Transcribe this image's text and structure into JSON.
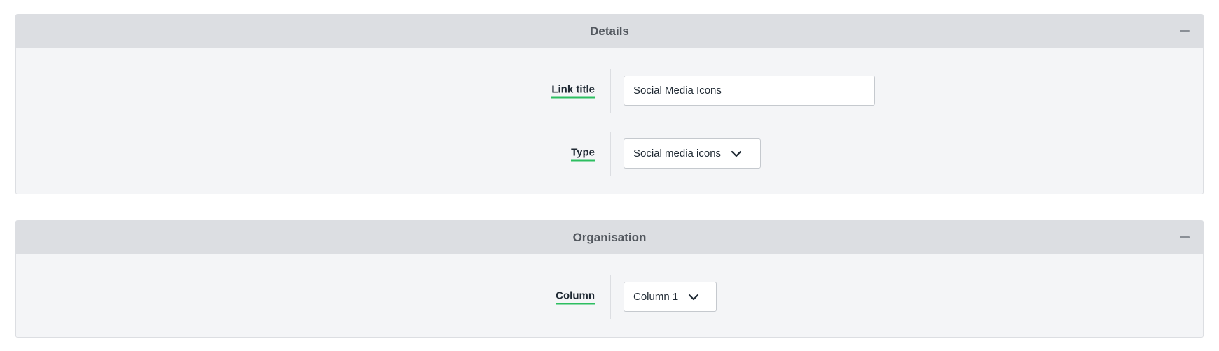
{
  "details": {
    "title": "Details",
    "collapse_icon": "minus-icon",
    "link_title": {
      "label": "Link title",
      "value": "Social Media Icons"
    },
    "type": {
      "label": "Type",
      "selected": "Social media icons",
      "icon": "chevron-down-icon"
    }
  },
  "organisation": {
    "title": "Organisation",
    "collapse_icon": "minus-icon",
    "column": {
      "label": "Column",
      "selected": "Column 1",
      "icon": "chevron-down-icon"
    }
  },
  "colors": {
    "header_bg": "#dcdee2",
    "panel_bg": "#f4f5f7",
    "label_underline": "#2dbe60"
  }
}
